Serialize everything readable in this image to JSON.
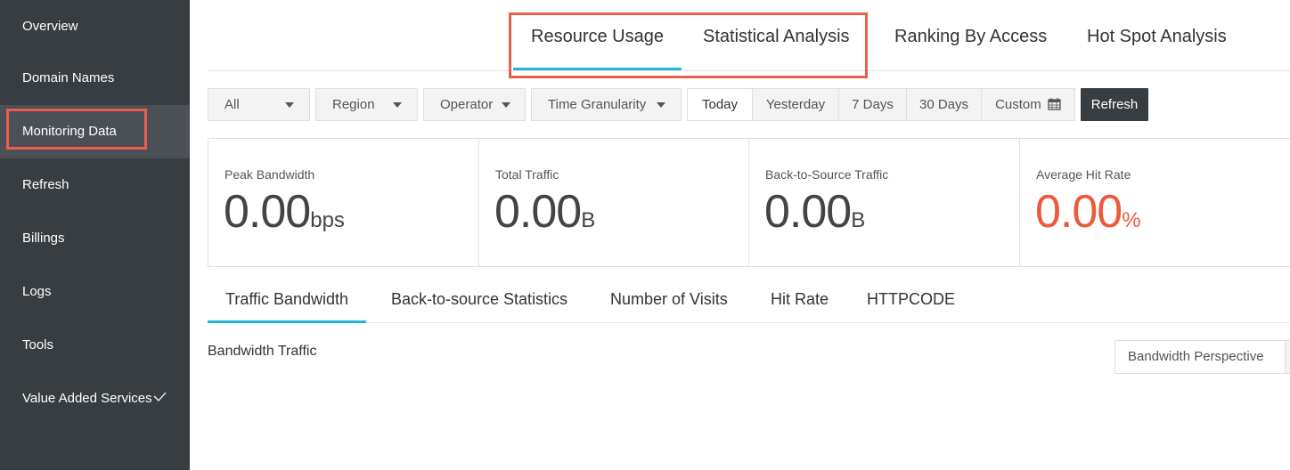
{
  "sidebar": {
    "items": [
      {
        "label": "Overview"
      },
      {
        "label": "Domain Names"
      },
      {
        "label": "Monitoring Data"
      },
      {
        "label": "Refresh"
      },
      {
        "label": "Billings"
      },
      {
        "label": "Logs"
      },
      {
        "label": "Tools"
      },
      {
        "label": "Value Added Services"
      }
    ],
    "active_item": "Monitoring Data",
    "expand_icon": "checkmark-icon"
  },
  "top_tabs": {
    "items": [
      {
        "label": "Resource Usage"
      },
      {
        "label": "Statistical Analysis"
      },
      {
        "label": "Ranking By Access"
      },
      {
        "label": "Hot Spot Analysis"
      }
    ],
    "active": "Resource Usage"
  },
  "filters": {
    "all": "All",
    "region": "Region",
    "operator": "Operator",
    "time_granularity": "Time Granularity",
    "ranges": [
      {
        "label": "Today"
      },
      {
        "label": "Yesterday"
      },
      {
        "label": "7 Days"
      },
      {
        "label": "30 Days"
      },
      {
        "label": "Custom"
      }
    ],
    "selected_range": "Today",
    "custom_icon": "calendar-icon",
    "refresh_label": "Refresh"
  },
  "stats": [
    {
      "label": "Peak Bandwidth",
      "value": "0.00",
      "unit": "bps"
    },
    {
      "label": "Total Traffic",
      "value": "0.00",
      "unit": "B"
    },
    {
      "label": "Back-to-Source Traffic",
      "value": "0.00",
      "unit": "B"
    },
    {
      "label": "Average Hit Rate",
      "value": "0.00",
      "unit": "%"
    }
  ],
  "sub_tabs": {
    "items": [
      {
        "label": "Traffic Bandwidth"
      },
      {
        "label": "Back-to-source Statistics"
      },
      {
        "label": "Number of Visits"
      },
      {
        "label": "Hit Rate"
      },
      {
        "label": "HTTPCODE"
      }
    ],
    "active": "Traffic Bandwidth"
  },
  "section": {
    "title": "Bandwidth Traffic",
    "perspective_label": "Bandwidth Perspective"
  },
  "colors": {
    "sidebar_bg": "#373d41",
    "accent": "#1fb8d6",
    "highlight": "#e8604c",
    "hit_rate": "#ec5a3e"
  }
}
